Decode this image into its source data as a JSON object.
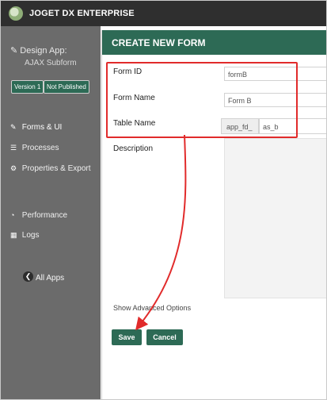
{
  "header": {
    "brand": "JOGET DX ENTERPRISE"
  },
  "sidebar": {
    "app_label": "Design App:",
    "app_name": "AJAX Subform",
    "version": "Version 1",
    "publish_status": "Not Published",
    "items": [
      {
        "label": "Forms & UI",
        "icon": "edit-icon"
      },
      {
        "label": "Processes",
        "icon": "list-icon"
      },
      {
        "label": "Properties & Export",
        "icon": "gear-icon"
      },
      {
        "label": "Performance",
        "icon": "dashboard-icon"
      },
      {
        "label": "Logs",
        "icon": "book-icon"
      }
    ],
    "all_apps": "All Apps"
  },
  "dialog": {
    "title": "CREATE NEW FORM",
    "form_id_label": "Form ID",
    "form_id_value": "formB",
    "form_name_label": "Form Name",
    "form_name_value": "Form B",
    "table_name_label": "Table Name",
    "table_prefix": "app_fd_",
    "table_name_value": "as_b",
    "description_label": "Description",
    "description_value": "",
    "advanced_label": "Show Advanced Options",
    "save_label": "Save",
    "cancel_label": "Cancel"
  },
  "colors": {
    "accent": "#2d6a55",
    "sidebar": "#6b6b6b",
    "topbar": "#2f2f2f",
    "annotation": "#e12b2b"
  }
}
